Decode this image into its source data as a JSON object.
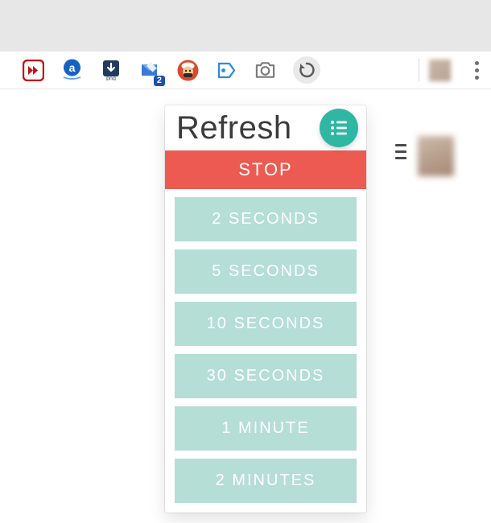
{
  "toolbar": {
    "extensions": [
      {
        "name": "fast-forward-icon"
      },
      {
        "name": "amazon-icon"
      },
      {
        "name": "png-download-icon"
      },
      {
        "name": "inbox-icon",
        "badge": "2"
      },
      {
        "name": "chef-avatar-icon"
      },
      {
        "name": "tag-icon"
      },
      {
        "name": "camera-icon"
      },
      {
        "name": "history-refresh-icon"
      }
    ]
  },
  "popup": {
    "title": "Refresh",
    "stop_label": "STOP",
    "options": [
      "2 SECONDS",
      "5 SECONDS",
      "10 SECONDS",
      "30 SECONDS",
      "1 MINUTE",
      "2 MINUTES"
    ]
  },
  "colors": {
    "stop": "#ed5a52",
    "option": "#b4ded6",
    "menu_btn": "#2fb7a3"
  }
}
